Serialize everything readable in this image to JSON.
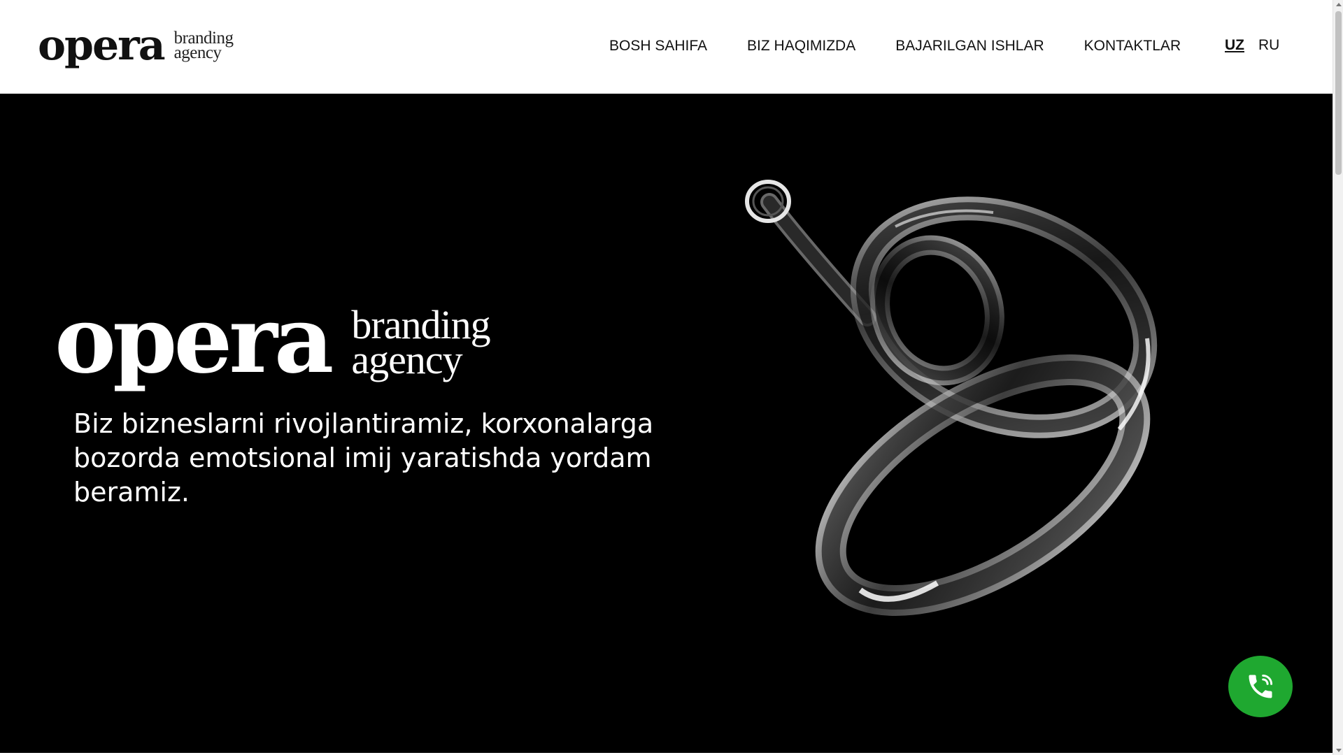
{
  "header": {
    "logo": {
      "word": "opera",
      "sub_line1": "branding",
      "sub_line2": "agency"
    },
    "nav": [
      {
        "label": "BOSH SAHIFA"
      },
      {
        "label": "BIZ HAQIMIZDA"
      },
      {
        "label": "BAJARILGAN ISHLAR"
      },
      {
        "label": "KONTAKTLAR"
      }
    ],
    "languages": [
      {
        "label": "UZ",
        "active": true
      },
      {
        "label": "RU",
        "active": false
      }
    ]
  },
  "hero": {
    "logo": {
      "word": "opera",
      "sub_line1": "branding",
      "sub_line2": "agency"
    },
    "tagline": "Biz bizneslarni rivojlantiramiz, korxonalarga bozorda emotsional imij yaratishda yordam beramiz.",
    "background_color": "#000000"
  },
  "call_button": {
    "icon": "phone-icon",
    "color": "#1fa830"
  }
}
